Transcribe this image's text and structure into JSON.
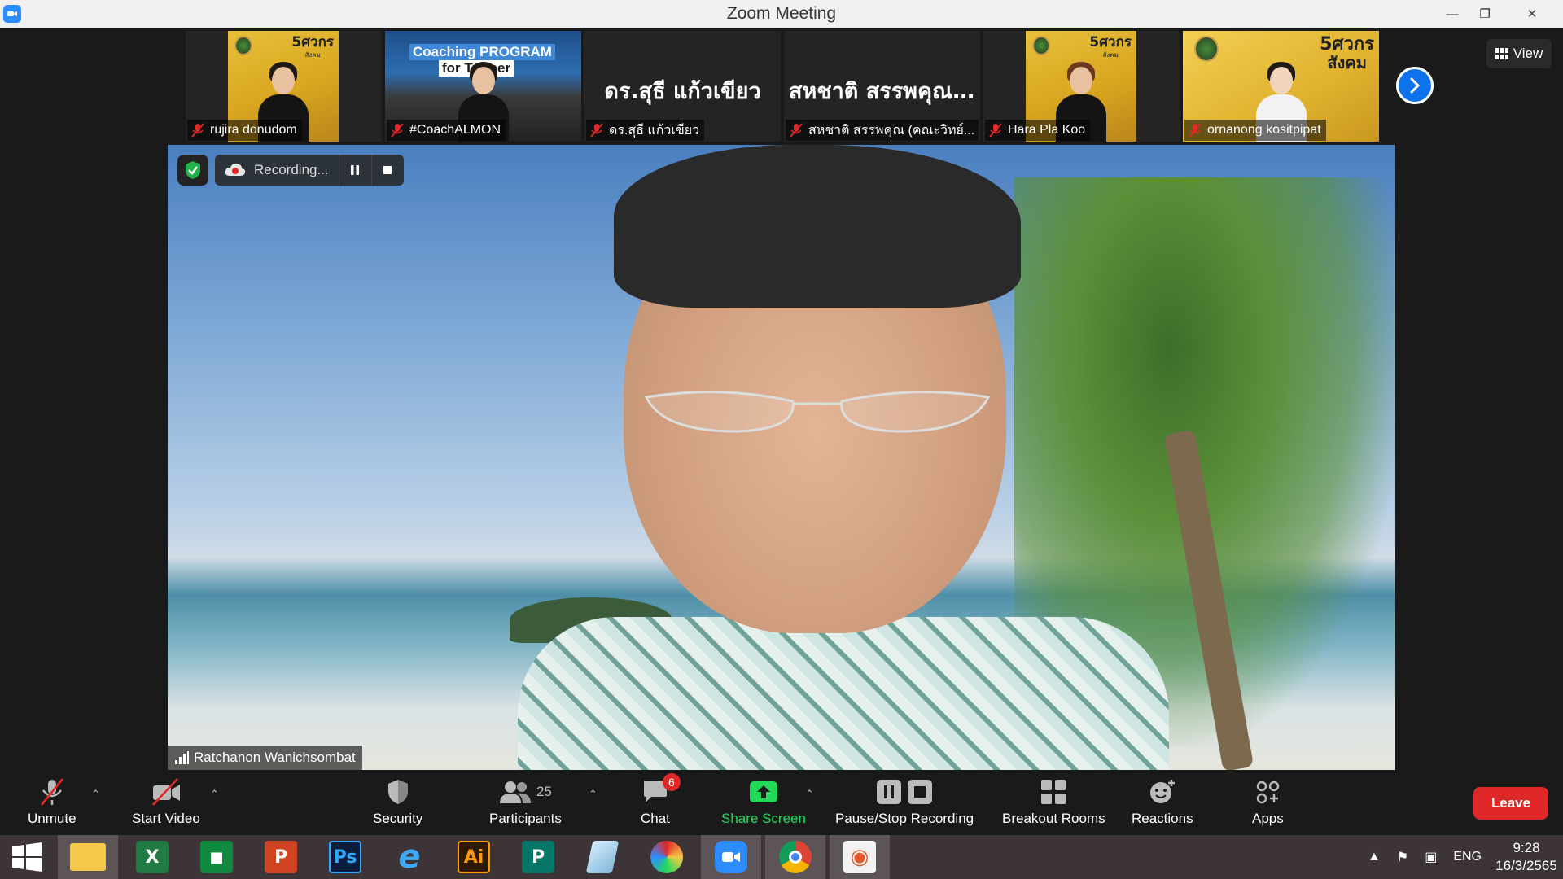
{
  "window": {
    "title": "Zoom Meeting"
  },
  "thumbnails": [
    {
      "name": "rujira donudom",
      "kind": "photo"
    },
    {
      "name": "#CoachALMON",
      "kind": "coach",
      "banner1": "Coaching PROGRAM",
      "banner2": "for Trainer"
    },
    {
      "name": "ดร.สุธี  แก้วเขียว",
      "kind": "text",
      "display": "ดร.สุธี  แก้วเขียว"
    },
    {
      "name": "สหชาติ สรรพคุณ (คณะวิทย์...",
      "kind": "text",
      "display": "สหชาติ สรรพคุณ..."
    },
    {
      "name": "Hara Pla Koo",
      "kind": "photo"
    },
    {
      "name": "ornanong kositpipat",
      "kind": "photo2"
    }
  ],
  "thumb_logo": {
    "line1": "5ศวกร",
    "line2": "สังคม"
  },
  "view_button": {
    "label": "View"
  },
  "recording": {
    "label": "Recording..."
  },
  "active_speaker": {
    "name": "Ratchanon Wanichsombat"
  },
  "toolbar": {
    "unmute": "Unmute",
    "start_video": "Start Video",
    "security": "Security",
    "participants": "Participants",
    "participants_count": "25",
    "chat": "Chat",
    "chat_badge": "6",
    "share_screen": "Share Screen",
    "pause_stop": "Pause/Stop Recording",
    "breakout": "Breakout Rooms",
    "reactions": "Reactions",
    "apps": "Apps",
    "leave": "Leave"
  },
  "taskbar": {
    "apps": [
      "start",
      "file-explorer",
      "excel",
      "store",
      "powerpoint",
      "photoshop",
      "internet-explorer",
      "illustrator",
      "publisher",
      "notepad",
      "photoscape",
      "zoom",
      "chrome",
      "photos"
    ],
    "ps_label": "Ps",
    "ai_label": "Ai",
    "language": "ENG",
    "time": "9:28",
    "date": "16/3/2565"
  },
  "colors": {
    "accent": "#0e72ed",
    "leave": "#e02828",
    "share_green": "#23d959",
    "taskbar": "#3c3436"
  }
}
